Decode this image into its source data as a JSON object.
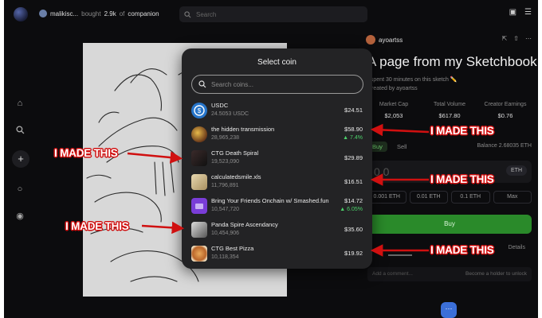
{
  "topbar": {
    "user": "malikisc...",
    "action": "bought",
    "amount": "2.9k",
    "of": "of",
    "coin": "companion",
    "search_placeholder": "Search"
  },
  "post": {
    "creator": "ayoartss",
    "title": "A page from my Sketchbook",
    "subtitle": "I spent 30 minutes on this sketch ✏️",
    "created_by": "Created by ayoartss",
    "stats": [
      {
        "label": "Market Cap",
        "value": "$2,053"
      },
      {
        "label": "Total Volume",
        "value": "$617.80"
      },
      {
        "label": "Creator Earnings",
        "value": "$0.76"
      }
    ],
    "buy_tab": "Buy",
    "sell_tab": "Sell",
    "balance": "Balance 2.68035 ETH",
    "amount_value": "0.0",
    "currency": "ETH",
    "quick_amounts": [
      "0.001 ETH",
      "0.01 ETH",
      "0.1 ETH",
      "Max"
    ],
    "buy_button": "Buy",
    "details_tab": "Details",
    "comment_placeholder": "Add a comment...",
    "comment_hint": "Become a holder to unlock"
  },
  "modal": {
    "title": "Select coin",
    "search_placeholder": "Search coins...",
    "coins": [
      {
        "name": "USDC",
        "sub": "24.5053 USDC",
        "price": "$24.51",
        "change": ""
      },
      {
        "name": "the hidden transmission",
        "sub": "28,965,238",
        "price": "$58.90",
        "change": "▲ 7.4%"
      },
      {
        "name": "CTG Death Spiral",
        "sub": "19,523,090",
        "price": "$29.89",
        "change": ""
      },
      {
        "name": "calculatedsmile.xls",
        "sub": "11,796,891",
        "price": "$16.51",
        "change": ""
      },
      {
        "name": "Bring Your Friends Onchain w/ Smashed.fun",
        "sub": "10,547,720",
        "price": "$14.72",
        "change": "▲ 6.05%"
      },
      {
        "name": "Panda Spire Ascendancy",
        "sub": "10,454,906",
        "price": "$35.60",
        "change": ""
      },
      {
        "name": "CTG Best Pizza",
        "sub": "10,118,354",
        "price": "$19.92",
        "change": ""
      }
    ]
  },
  "annotations": {
    "made_label": "I MADE THIS",
    "color": "#d01010"
  },
  "colors": {
    "buy_green": "#2a8a2a",
    "change_green": "#4cd06a",
    "usdc_blue": "#2775ca"
  }
}
